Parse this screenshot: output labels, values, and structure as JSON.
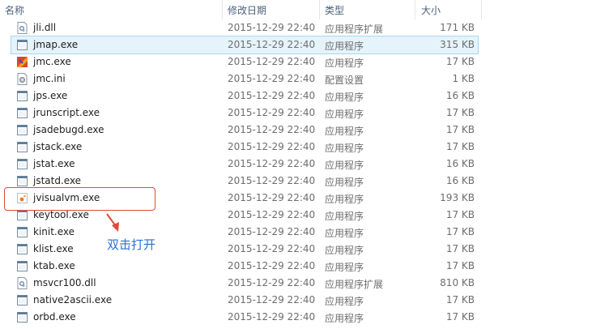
{
  "columns": {
    "name": "名称",
    "date": "修改日期",
    "type": "类型",
    "size": "大小"
  },
  "files": [
    {
      "name": "jli.dll",
      "date": "2015-12-29 22:40",
      "type": "应用程序扩展",
      "size": "171 KB",
      "icon": "dll-icon"
    },
    {
      "name": "jmap.exe",
      "date": "2015-12-29 22:40",
      "type": "应用程序",
      "size": "315 KB",
      "icon": "exe-icon",
      "selected": true
    },
    {
      "name": "jmc.exe",
      "date": "2015-12-29 22:40",
      "type": "应用程序",
      "size": "17 KB",
      "icon": "jmc-app-icon"
    },
    {
      "name": "jmc.ini",
      "date": "2015-12-29 22:40",
      "type": "配置设置",
      "size": "1 KB",
      "icon": "ini-icon"
    },
    {
      "name": "jps.exe",
      "date": "2015-12-29 22:40",
      "type": "应用程序",
      "size": "16 KB",
      "icon": "exe-icon"
    },
    {
      "name": "jrunscript.exe",
      "date": "2015-12-29 22:40",
      "type": "应用程序",
      "size": "17 KB",
      "icon": "exe-icon"
    },
    {
      "name": "jsadebugd.exe",
      "date": "2015-12-29 22:40",
      "type": "应用程序",
      "size": "17 KB",
      "icon": "exe-icon"
    },
    {
      "name": "jstack.exe",
      "date": "2015-12-29 22:40",
      "type": "应用程序",
      "size": "17 KB",
      "icon": "exe-icon"
    },
    {
      "name": "jstat.exe",
      "date": "2015-12-29 22:40",
      "type": "应用程序",
      "size": "16 KB",
      "icon": "exe-icon"
    },
    {
      "name": "jstatd.exe",
      "date": "2015-12-29 22:40",
      "type": "应用程序",
      "size": "16 KB",
      "icon": "exe-icon"
    },
    {
      "name": "jvisualvm.exe",
      "date": "2015-12-29 22:40",
      "type": "应用程序",
      "size": "193 KB",
      "icon": "jvisualvm-icon"
    },
    {
      "name": "keytool.exe",
      "date": "2015-12-29 22:40",
      "type": "应用程序",
      "size": "17 KB",
      "icon": "exe-icon"
    },
    {
      "name": "kinit.exe",
      "date": "2015-12-29 22:40",
      "type": "应用程序",
      "size": "17 KB",
      "icon": "exe-icon"
    },
    {
      "name": "klist.exe",
      "date": "2015-12-29 22:40",
      "type": "应用程序",
      "size": "17 KB",
      "icon": "exe-icon"
    },
    {
      "name": "ktab.exe",
      "date": "2015-12-29 22:40",
      "type": "应用程序",
      "size": "17 KB",
      "icon": "exe-icon"
    },
    {
      "name": "msvcr100.dll",
      "date": "2015-12-29 22:40",
      "type": "应用程序扩展",
      "size": "810 KB",
      "icon": "dll-icon"
    },
    {
      "name": "native2ascii.exe",
      "date": "2015-12-29 22:40",
      "type": "应用程序",
      "size": "17 KB",
      "icon": "exe-icon"
    },
    {
      "name": "orbd.exe",
      "date": "2015-12-29 22:40",
      "type": "应用程序",
      "size": "17 KB",
      "icon": "exe-icon"
    }
  ],
  "annotation": {
    "text": "双击打开",
    "color": "#2a6fd6",
    "highlight_color": "#e04a3a"
  }
}
